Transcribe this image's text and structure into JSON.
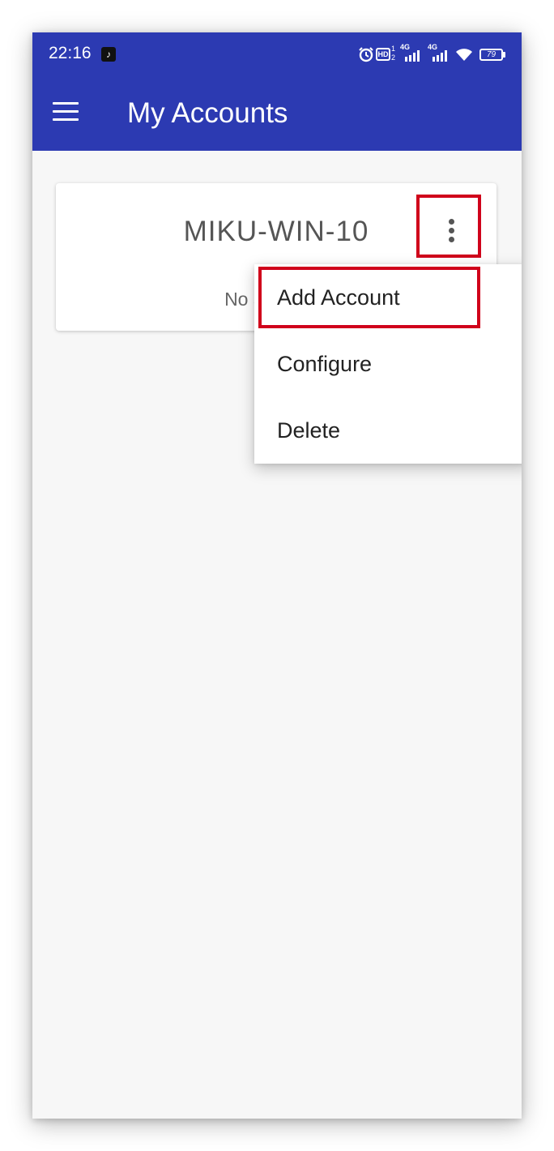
{
  "status_bar": {
    "time": "22:16",
    "notification_icon": "tiktok-icon",
    "icons": [
      "alarm-icon",
      "hd-icon",
      "signal-4g-icon",
      "signal-4g-icon",
      "wifi-icon",
      "battery-icon"
    ],
    "hd_label": "HD",
    "hd_sub_1": "1",
    "hd_sub_2": "2",
    "network_1": "4G",
    "network_2": "4G",
    "battery_level": "79"
  },
  "app_bar": {
    "title": "My Accounts",
    "background": "#2c3ab2"
  },
  "account_card": {
    "title": "MIKU-WIN-10",
    "status_text": "No accounts"
  },
  "menu": {
    "items": [
      {
        "label": "Add Account"
      },
      {
        "label": "Configure"
      },
      {
        "label": "Delete"
      }
    ]
  },
  "annotation_color": "#d0021b"
}
